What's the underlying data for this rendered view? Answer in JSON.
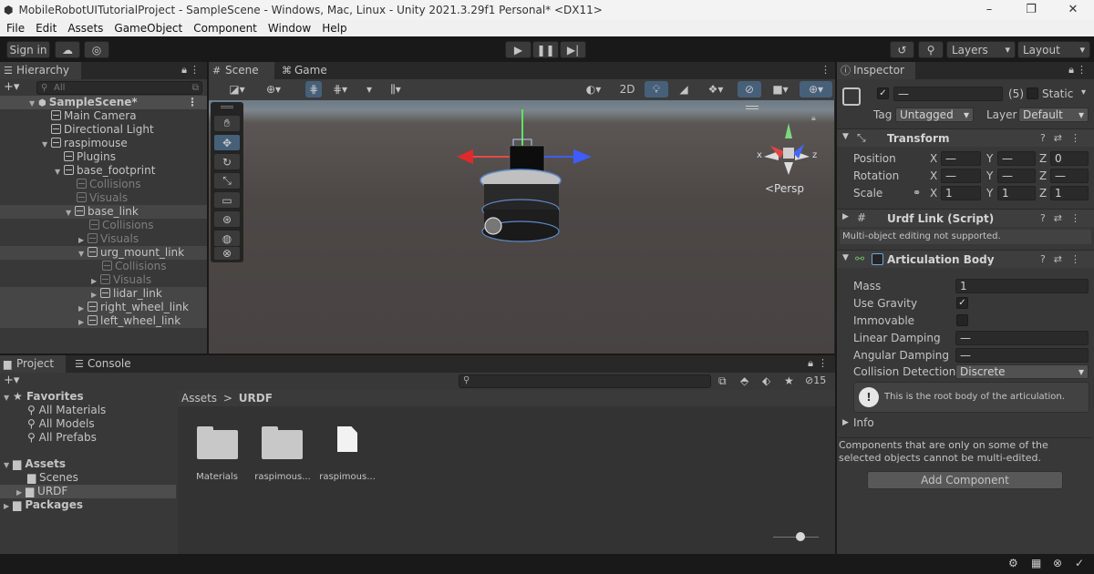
{
  "window": {
    "title": "MobileRobotUITutorialProject - SampleScene - Windows, Mac, Linux - Unity 2021.3.29f1 Personal* <DX11>"
  },
  "menu": [
    "File",
    "Edit",
    "Assets",
    "GameObject",
    "Component",
    "Window",
    "Help"
  ],
  "toolbar": {
    "sign_in": "Sign in",
    "layers": "Layers",
    "layout": "Layout"
  },
  "hierarchy": {
    "tab": "Hierarchy",
    "search_placeholder": "All",
    "items": [
      {
        "label": "SampleScene*"
      },
      {
        "label": "Main Camera"
      },
      {
        "label": "Directional Light"
      },
      {
        "label": "raspimouse"
      },
      {
        "label": "Plugins"
      },
      {
        "label": "base_footprint"
      },
      {
        "label": "Collisions"
      },
      {
        "label": "Visuals"
      },
      {
        "label": "base_link"
      },
      {
        "label": "Collisions"
      },
      {
        "label": "Visuals"
      },
      {
        "label": "urg_mount_link"
      },
      {
        "label": "Collisions"
      },
      {
        "label": "Visuals"
      },
      {
        "label": "lidar_link"
      },
      {
        "label": "right_wheel_link"
      },
      {
        "label": "left_wheel_link"
      }
    ]
  },
  "scene": {
    "tabs": [
      "Scene",
      "Game"
    ],
    "mode_2d": "2D",
    "persp": "<Persp",
    "gizmo_x": "x",
    "gizmo_z": "z"
  },
  "inspector": {
    "tab": "Inspector",
    "name_value": "—",
    "count": "(5)",
    "static_label": "Static",
    "tag_label": "Tag",
    "tag_value": "Untagged",
    "layer_label": "Layer",
    "layer_value": "Default",
    "transform": {
      "title": "Transform",
      "position": "Position",
      "rotation": "Rotation",
      "scale": "Scale",
      "x": "X",
      "y": "Y",
      "z": "Z",
      "pos_x": "—",
      "pos_y": "—",
      "pos_z": "0",
      "rot_x": "—",
      "rot_y": "—",
      "rot_z": "—",
      "scl_x": "1",
      "scl_y": "1",
      "scl_z": "1"
    },
    "urdf_link": {
      "title": "Urdf Link (Script)",
      "note": "Multi-object editing not supported."
    },
    "articulation": {
      "title": "Articulation Body",
      "mass_label": "Mass",
      "mass_value": "1",
      "use_gravity": "Use Gravity",
      "immovable": "Immovable",
      "linear_damping": "Linear Damping",
      "linear_damping_value": "—",
      "angular_damping": "Angular Damping",
      "angular_damping_value": "—",
      "collision_detection": "Collision Detection",
      "collision_value": "Discrete",
      "info_text": "This is the root body of the articulation.",
      "info_foldout": "Info"
    },
    "multi_note": "Components that are only on some of the selected objects cannot be multi-edited.",
    "add_component": "Add Component"
  },
  "project": {
    "tabs": [
      "Project",
      "Console"
    ],
    "hidden_count": "15",
    "favorites_label": "Favorites",
    "favorites": [
      "All Materials",
      "All Models",
      "All Prefabs"
    ],
    "assets_label": "Assets",
    "assets_children": [
      "Scenes",
      "URDF"
    ],
    "packages_label": "Packages",
    "breadcrumb_root": "Assets",
    "breadcrumb_sep": ">",
    "breadcrumb_current": "URDF",
    "files": [
      {
        "label": "Materials",
        "type": "folder"
      },
      {
        "label": "raspimous...",
        "type": "folder"
      },
      {
        "label": "raspimous...",
        "type": "file"
      }
    ]
  },
  "colors": {
    "selection": "#4d4d4d",
    "accent_blue": "#3a79bb",
    "play_bar": "#191919"
  }
}
